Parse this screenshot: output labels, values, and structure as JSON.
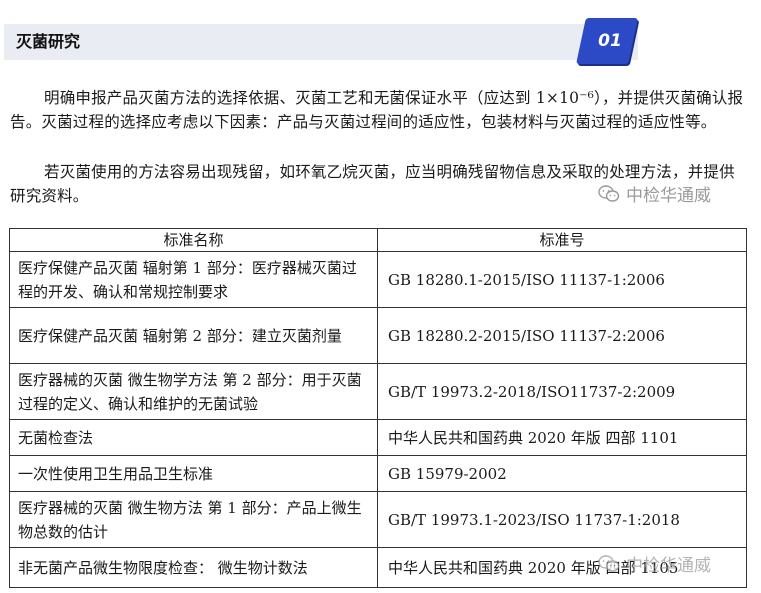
{
  "section": {
    "title": "灭菌研究",
    "badge": "01"
  },
  "paragraphs": [
    "明确申报产品灭菌方法的选择依据、灭菌工艺和无菌保证水平（应达到 1×10⁻⁶），并提供灭菌确认报告。灭菌过程的选择应考虑以下因素：产品与灭菌过程间的适应性，包装材料与灭菌过程的适应性等。",
    "若灭菌使用的方法容易出现残留，如环氧乙烷灭菌，应当明确残留物信息及采取的处理方法，并提供研究资料。"
  ],
  "watermark": {
    "text": "中检华通威"
  },
  "table": {
    "headers": [
      "标准名称",
      "标准号"
    ],
    "rows": [
      {
        "name": "医疗保健产品灭菌 辐射第 1 部分：医疗器械灭菌过程的开发、确认和常规控制要求",
        "code": "GB 18280.1-2015/ISO 11137-1:2006"
      },
      {
        "name": "医疗保健产品灭菌 辐射第 2 部分：建立灭菌剂量",
        "code": "GB 18280.2-2015/ISO 11137-2:2006"
      },
      {
        "name": "医疗器械的灭菌 微生物学方法 第 2 部分：用于灭菌过程的定义、确认和维护的无菌试验",
        "code": "GB/T 19973.2-2018/ISO11737-2:2009"
      },
      {
        "name": "无菌检查法",
        "code": "中华人民共和国药典 2020 年版 四部 1101"
      },
      {
        "name": "一次性使用卫生用品卫生标准",
        "code": "GB 15979-2002"
      },
      {
        "name": "医疗器械的灭菌 微生物方法 第 1 部分：产品上微生物总数的估计",
        "code": "GB/T 19973.1-2023/ISO 11737-1:2018"
      },
      {
        "name": "非无菌产品微生物限度检查：  微生物计数法",
        "code": "中华人民共和国药典 2020 年版 四部 1105"
      }
    ]
  }
}
